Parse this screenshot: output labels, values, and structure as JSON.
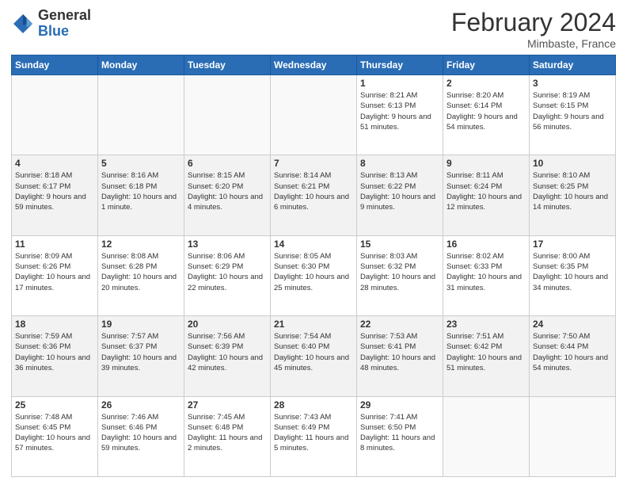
{
  "header": {
    "logo_general": "General",
    "logo_blue": "Blue",
    "month_title": "February 2024",
    "subtitle": "Mimbaste, France"
  },
  "columns": [
    "Sunday",
    "Monday",
    "Tuesday",
    "Wednesday",
    "Thursday",
    "Friday",
    "Saturday"
  ],
  "weeks": [
    {
      "days": [
        {
          "date": "",
          "info": ""
        },
        {
          "date": "",
          "info": ""
        },
        {
          "date": "",
          "info": ""
        },
        {
          "date": "",
          "info": ""
        },
        {
          "date": "1",
          "info": "Sunrise: 8:21 AM\nSunset: 6:13 PM\nDaylight: 9 hours\nand 51 minutes."
        },
        {
          "date": "2",
          "info": "Sunrise: 8:20 AM\nSunset: 6:14 PM\nDaylight: 9 hours\nand 54 minutes."
        },
        {
          "date": "3",
          "info": "Sunrise: 8:19 AM\nSunset: 6:15 PM\nDaylight: 9 hours\nand 56 minutes."
        }
      ]
    },
    {
      "days": [
        {
          "date": "4",
          "info": "Sunrise: 8:18 AM\nSunset: 6:17 PM\nDaylight: 9 hours\nand 59 minutes."
        },
        {
          "date": "5",
          "info": "Sunrise: 8:16 AM\nSunset: 6:18 PM\nDaylight: 10 hours\nand 1 minute."
        },
        {
          "date": "6",
          "info": "Sunrise: 8:15 AM\nSunset: 6:20 PM\nDaylight: 10 hours\nand 4 minutes."
        },
        {
          "date": "7",
          "info": "Sunrise: 8:14 AM\nSunset: 6:21 PM\nDaylight: 10 hours\nand 6 minutes."
        },
        {
          "date": "8",
          "info": "Sunrise: 8:13 AM\nSunset: 6:22 PM\nDaylight: 10 hours\nand 9 minutes."
        },
        {
          "date": "9",
          "info": "Sunrise: 8:11 AM\nSunset: 6:24 PM\nDaylight: 10 hours\nand 12 minutes."
        },
        {
          "date": "10",
          "info": "Sunrise: 8:10 AM\nSunset: 6:25 PM\nDaylight: 10 hours\nand 14 minutes."
        }
      ]
    },
    {
      "days": [
        {
          "date": "11",
          "info": "Sunrise: 8:09 AM\nSunset: 6:26 PM\nDaylight: 10 hours\nand 17 minutes."
        },
        {
          "date": "12",
          "info": "Sunrise: 8:08 AM\nSunset: 6:28 PM\nDaylight: 10 hours\nand 20 minutes."
        },
        {
          "date": "13",
          "info": "Sunrise: 8:06 AM\nSunset: 6:29 PM\nDaylight: 10 hours\nand 22 minutes."
        },
        {
          "date": "14",
          "info": "Sunrise: 8:05 AM\nSunset: 6:30 PM\nDaylight: 10 hours\nand 25 minutes."
        },
        {
          "date": "15",
          "info": "Sunrise: 8:03 AM\nSunset: 6:32 PM\nDaylight: 10 hours\nand 28 minutes."
        },
        {
          "date": "16",
          "info": "Sunrise: 8:02 AM\nSunset: 6:33 PM\nDaylight: 10 hours\nand 31 minutes."
        },
        {
          "date": "17",
          "info": "Sunrise: 8:00 AM\nSunset: 6:35 PM\nDaylight: 10 hours\nand 34 minutes."
        }
      ]
    },
    {
      "days": [
        {
          "date": "18",
          "info": "Sunrise: 7:59 AM\nSunset: 6:36 PM\nDaylight: 10 hours\nand 36 minutes."
        },
        {
          "date": "19",
          "info": "Sunrise: 7:57 AM\nSunset: 6:37 PM\nDaylight: 10 hours\nand 39 minutes."
        },
        {
          "date": "20",
          "info": "Sunrise: 7:56 AM\nSunset: 6:39 PM\nDaylight: 10 hours\nand 42 minutes."
        },
        {
          "date": "21",
          "info": "Sunrise: 7:54 AM\nSunset: 6:40 PM\nDaylight: 10 hours\nand 45 minutes."
        },
        {
          "date": "22",
          "info": "Sunrise: 7:53 AM\nSunset: 6:41 PM\nDaylight: 10 hours\nand 48 minutes."
        },
        {
          "date": "23",
          "info": "Sunrise: 7:51 AM\nSunset: 6:42 PM\nDaylight: 10 hours\nand 51 minutes."
        },
        {
          "date": "24",
          "info": "Sunrise: 7:50 AM\nSunset: 6:44 PM\nDaylight: 10 hours\nand 54 minutes."
        }
      ]
    },
    {
      "days": [
        {
          "date": "25",
          "info": "Sunrise: 7:48 AM\nSunset: 6:45 PM\nDaylight: 10 hours\nand 57 minutes."
        },
        {
          "date": "26",
          "info": "Sunrise: 7:46 AM\nSunset: 6:46 PM\nDaylight: 10 hours\nand 59 minutes."
        },
        {
          "date": "27",
          "info": "Sunrise: 7:45 AM\nSunset: 6:48 PM\nDaylight: 11 hours\nand 2 minutes."
        },
        {
          "date": "28",
          "info": "Sunrise: 7:43 AM\nSunset: 6:49 PM\nDaylight: 11 hours\nand 5 minutes."
        },
        {
          "date": "29",
          "info": "Sunrise: 7:41 AM\nSunset: 6:50 PM\nDaylight: 11 hours\nand 8 minutes."
        },
        {
          "date": "",
          "info": ""
        },
        {
          "date": "",
          "info": ""
        }
      ]
    }
  ]
}
